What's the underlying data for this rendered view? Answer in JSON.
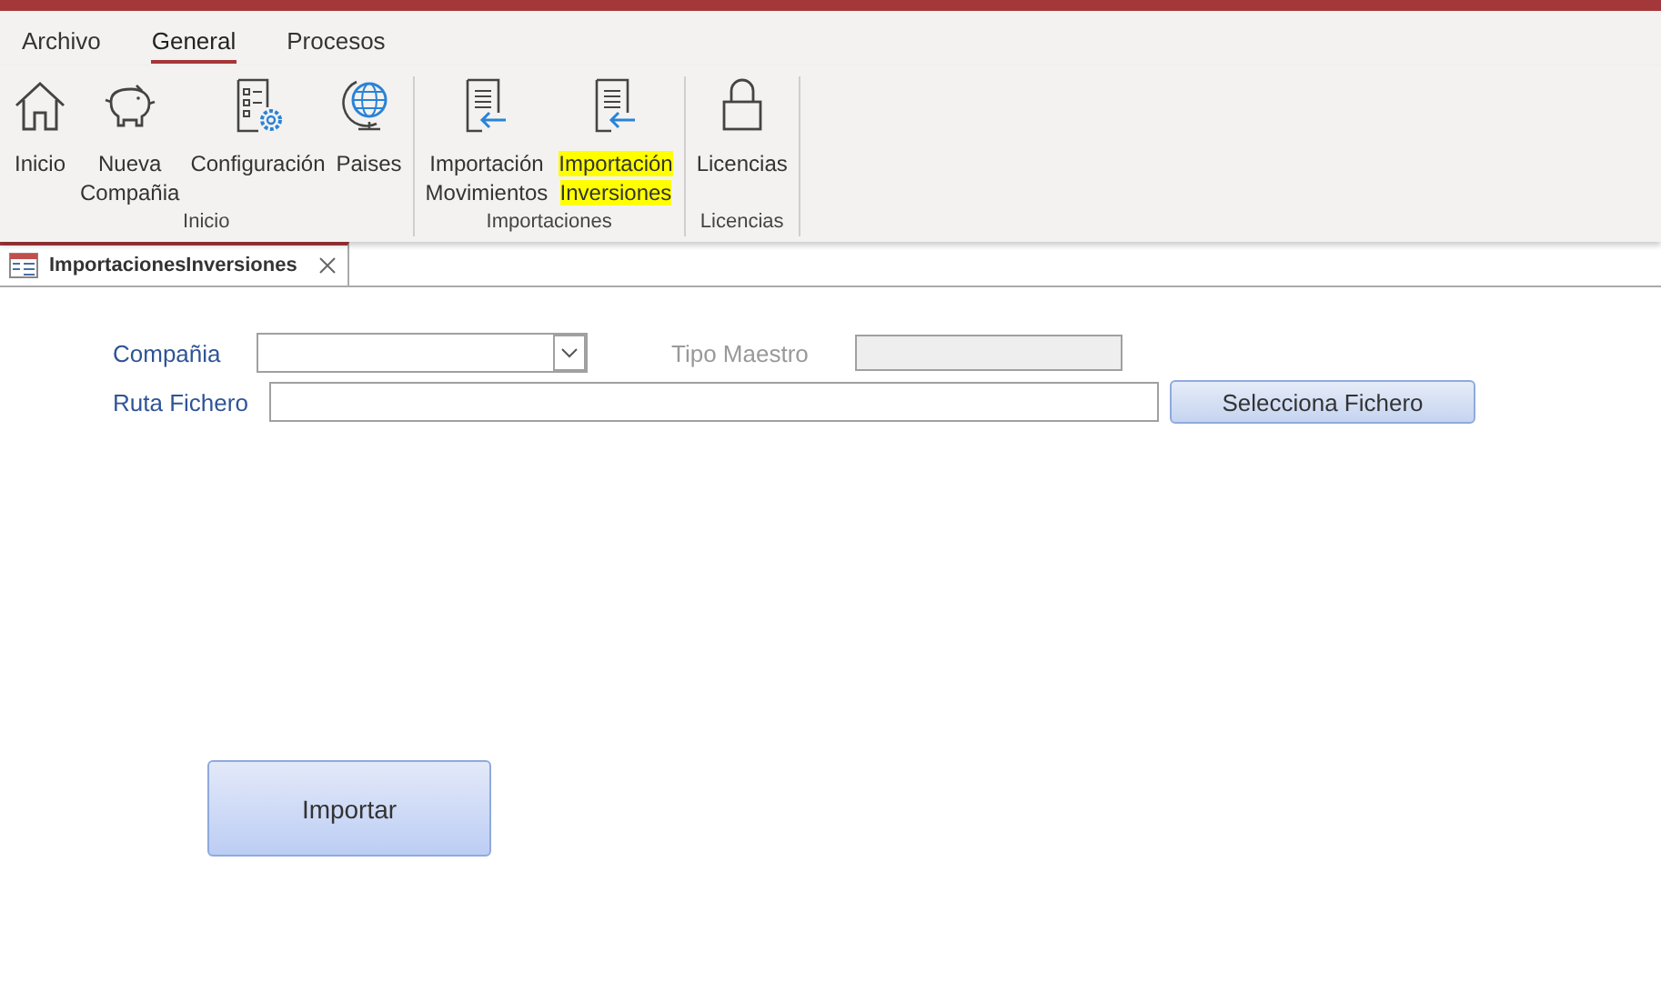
{
  "menu_tabs": [
    {
      "label": "Archivo",
      "selected": false
    },
    {
      "label": "General",
      "selected": true
    },
    {
      "label": "Procesos",
      "selected": false
    }
  ],
  "ribbon_groups": [
    {
      "label": "Inicio",
      "buttons": [
        {
          "kind": "home",
          "label": "Inicio",
          "highlighted": false
        },
        {
          "kind": "piggy",
          "label": "Nueva\nCompañia",
          "highlighted": false
        },
        {
          "kind": "settings",
          "label": "Configuración",
          "highlighted": false
        },
        {
          "kind": "globe",
          "label": "Paises",
          "highlighted": false
        }
      ]
    },
    {
      "label": "Importaciones",
      "buttons": [
        {
          "kind": "import",
          "label": "Importación\nMovimientos",
          "highlighted": false
        },
        {
          "kind": "import",
          "label": "Importación\nInversiones",
          "highlighted": true
        }
      ]
    },
    {
      "label": "Licencias",
      "buttons": [
        {
          "kind": "lock",
          "label": "Licencias",
          "highlighted": false
        }
      ]
    }
  ],
  "document_tab": {
    "title": "ImportacionesInversiones"
  },
  "form": {
    "company_label": "Compañia",
    "type_label": "Tipo Maestro",
    "type_disabled": true,
    "path_label": "Ruta Fichero",
    "select_button": "Selecciona Fichero",
    "import_button": "Importar"
  }
}
